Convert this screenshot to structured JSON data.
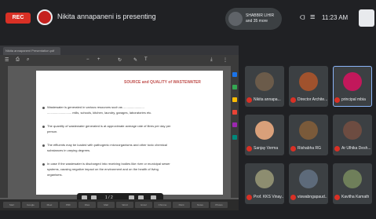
{
  "topbar": {
    "rec_label": "REC",
    "presenter_text": "Nikita annapaneni is presenting",
    "pill_text": "SHABBIR LIHIR and 35 more",
    "clock": "11:23 AM"
  },
  "share": {
    "tab_label": "Nikita annapaneni Presentation.pdf",
    "page_title": "SOURCE and QUALITY of WASTEWATER",
    "lines": [
      "Wastewater is generated in various resources such as ........................",
      "............................ mills, schools, kitchen, laundry, garages, laboratories etc.",
      "The quantity of wastewater generated is at approximate average rate of litres per day per",
      "person.",
      "The effluents may be loaded with pathogenic microorganisms and other toxic chemical",
      "substances in varying degrees.",
      "In case if the wastewater is discharged into receiving bodies like river or municipal sewer",
      "systems, causing negative impact on the environment and on the health of living",
      "organisms."
    ],
    "pdfbar_text": "1 / 2",
    "taskbar_items": [
      "Start",
      "Google",
      "Meet",
      "PDF",
      "Files",
      "Mail",
      "Word",
      "Excel",
      "Chrome",
      "Paint",
      "Notes",
      "Photos"
    ]
  },
  "participants": [
    {
      "name": "Nikita annapa...",
      "color": "#6b5b4a",
      "active": false
    },
    {
      "name": "Director Archite...",
      "color": "#a0522d",
      "active": false
    },
    {
      "name": "principal mbia",
      "color": "#c2185b",
      "active": true
    },
    {
      "name": "Sanjay Verma",
      "color": "#d9a07a",
      "active": false
    },
    {
      "name": "Rishabha RG",
      "color": "#7a5a3a",
      "active": false
    },
    {
      "name": "Ar Ulhika Desh...",
      "color": "#6d4c41",
      "active": false
    },
    {
      "name": "Prof. KKS Vinay...",
      "color": "#8d8d70",
      "active": false
    },
    {
      "name": "viswabngapaud...",
      "color": "#5d6a7a",
      "active": false
    },
    {
      "name": "Kavitha Kamath",
      "color": "#6f7f5a",
      "active": false
    }
  ]
}
